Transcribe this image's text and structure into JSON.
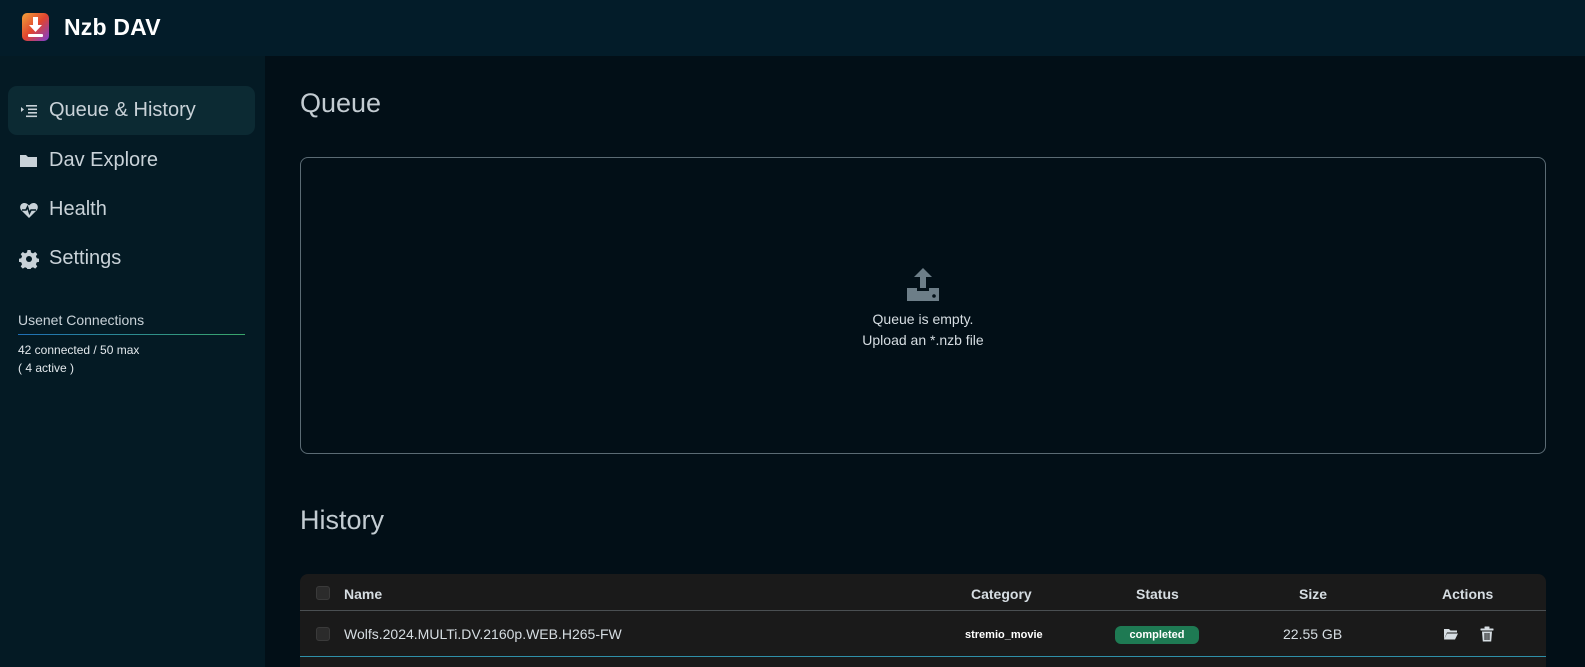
{
  "app": {
    "title": "Nzb DAV"
  },
  "sidebar": {
    "items": [
      {
        "label": "Queue & History",
        "icon": "queue-list-icon",
        "active": true
      },
      {
        "label": "Dav Explore",
        "icon": "folder-icon",
        "active": false
      },
      {
        "label": "Health",
        "icon": "heart-pulse-icon",
        "active": false
      },
      {
        "label": "Settings",
        "icon": "gear-icon",
        "active": false
      }
    ],
    "connections": {
      "title": "Usenet Connections",
      "summary": "42 connected / 50 max",
      "active": "( 4 active )"
    }
  },
  "queue": {
    "title": "Queue",
    "empty_line1": "Queue is empty.",
    "empty_line2": "Upload an *.nzb file",
    "icon": "upload-icon"
  },
  "history": {
    "title": "History",
    "columns": {
      "name": "Name",
      "category": "Category",
      "status": "Status",
      "size": "Size",
      "actions": "Actions"
    },
    "rows": [
      {
        "name": "Wolfs.2024.MULTi.DV.2160p.WEB.H265-FW",
        "category": "stremio_movie",
        "status": "completed",
        "size": "22.55 GB"
      }
    ]
  },
  "colors": {
    "topbar": "#031c29",
    "sidebar": "#041a24",
    "background": "#020f17",
    "status_completed": "#1e7a53"
  }
}
